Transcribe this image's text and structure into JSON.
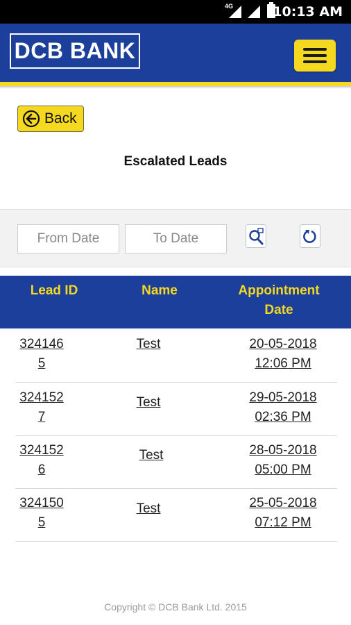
{
  "status_bar": {
    "network": "4G",
    "time": "10:13 AM"
  },
  "header": {
    "logo_text": "DCB BANK",
    "menu_icon": "hamburger-menu-icon"
  },
  "back_button": {
    "label": "Back",
    "icon": "arrow-left-circle-icon"
  },
  "page_title": "Escalated Leads",
  "filter": {
    "from_placeholder": "From Date",
    "to_placeholder": "To Date",
    "search_icon": "search-calendar-icon",
    "reset_icon": "refresh-icon"
  },
  "table": {
    "columns": [
      "Lead ID",
      "Name",
      "Appointment",
      "Date"
    ],
    "rows": [
      {
        "lead_id_1": "324146",
        "lead_id_2": "5",
        "name": "Test",
        "date": "20-05-2018",
        "time": "12:06 PM"
      },
      {
        "lead_id_1": "324152",
        "lead_id_2": "7",
        "name": "Test",
        "date": "29-05-2018",
        "time": "02:36 PM"
      },
      {
        "lead_id_1": "324152",
        "lead_id_2": "6",
        "name": "Test",
        "date": "28-05-2018",
        "time": "05:00 PM"
      },
      {
        "lead_id_1": "324150",
        "lead_id_2": "5",
        "name": "Test",
        "date": "25-05-2018",
        "time": "07:12 PM"
      }
    ]
  },
  "footer": "Copyright © DCB Bank Ltd. 2015",
  "colors": {
    "brand_blue": "#1d3f9c",
    "brand_yellow": "#f5d820"
  }
}
